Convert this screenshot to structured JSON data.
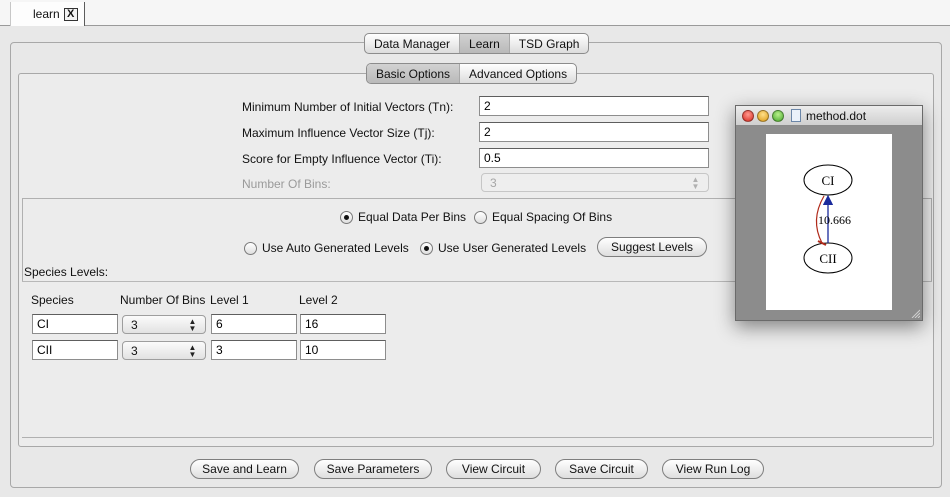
{
  "doc_tab": {
    "label": "learn",
    "close_glyph": "X"
  },
  "main_tabs": [
    {
      "label": "Data Manager",
      "selected": false
    },
    {
      "label": "Learn",
      "selected": true
    },
    {
      "label": "TSD Graph",
      "selected": false
    }
  ],
  "option_tabs": [
    {
      "label": "Basic Options",
      "selected": true
    },
    {
      "label": "Advanced Options",
      "selected": false
    }
  ],
  "form": {
    "tn_label": "Minimum Number of Initial Vectors (Tn):",
    "tn_value": "2",
    "tj_label": "Maximum Influence Vector Size (Tj):",
    "tj_value": "2",
    "ti_label": "Score for Empty Influence Vector (Ti):",
    "ti_value": "0.5",
    "bins_label": "Number Of Bins:",
    "bins_value": "3"
  },
  "binning": {
    "equal_data": "Equal Data Per Bins",
    "equal_spacing": "Equal Spacing Of Bins",
    "selected": "equal_data"
  },
  "levels_mode": {
    "auto": "Use Auto Generated Levels",
    "user": "Use User Generated Levels",
    "selected": "user",
    "suggest_button": "Suggest Levels"
  },
  "species_levels": {
    "title": "Species Levels:",
    "headers": {
      "species": "Species",
      "bins": "Number Of Bins",
      "level1": "Level 1",
      "level2": "Level 2"
    },
    "rows": [
      {
        "species": "CI",
        "bins": "3",
        "level1": "6",
        "level2": "16"
      },
      {
        "species": "CII",
        "bins": "3",
        "level1": "3",
        "level2": "10"
      }
    ]
  },
  "graph_window": {
    "title": "method.dot",
    "node_top": "CI",
    "node_bottom": "CII",
    "edge_label": "10.666",
    "colors": {
      "activation": "#1a2a9c",
      "repression": "#b02a1a"
    }
  },
  "buttons": {
    "save_learn": "Save and Learn",
    "save_params": "Save Parameters",
    "view_circuit": "View Circuit",
    "save_circuit": "Save Circuit",
    "view_log": "View Run Log"
  }
}
